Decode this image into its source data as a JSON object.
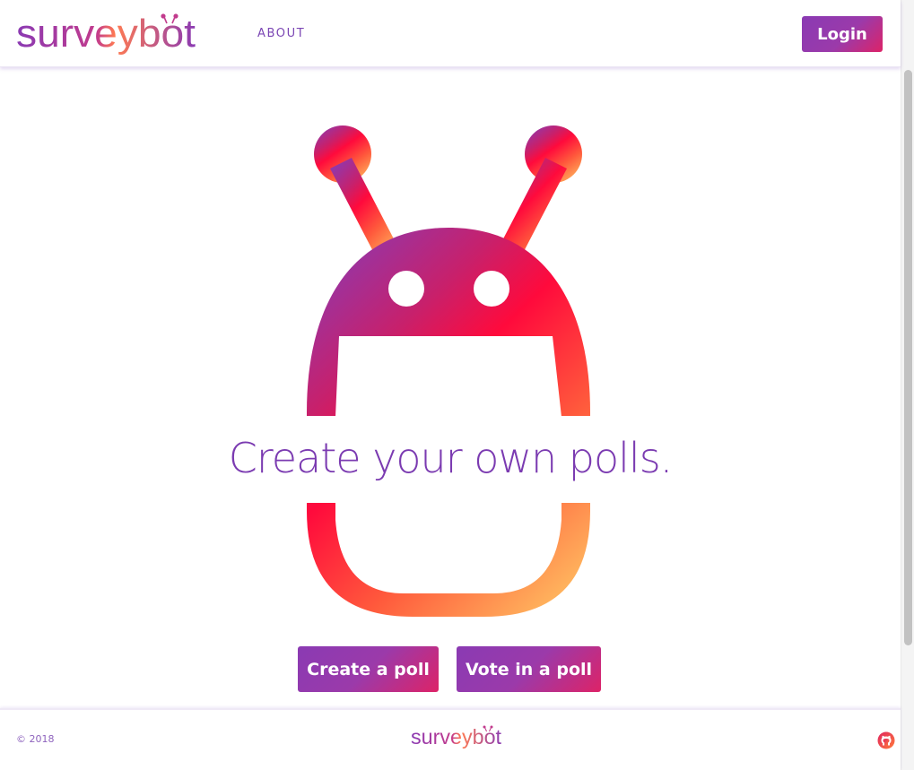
{
  "header": {
    "logo_text": "surveybot",
    "nav_about": "ABOUT",
    "login_label": "Login"
  },
  "hero": {
    "headline": "Create your own polls.",
    "create_label": "Create a poll",
    "vote_label": "Vote in a poll"
  },
  "footer": {
    "copyright": "© 2018",
    "logo_text": "surveybot",
    "github_icon": "github-icon"
  },
  "colors": {
    "brand_purple": "#7b3bb1",
    "brand_magenta": "#dd2367",
    "brand_red": "#ff0a3c",
    "brand_orange": "#ffb15c"
  }
}
